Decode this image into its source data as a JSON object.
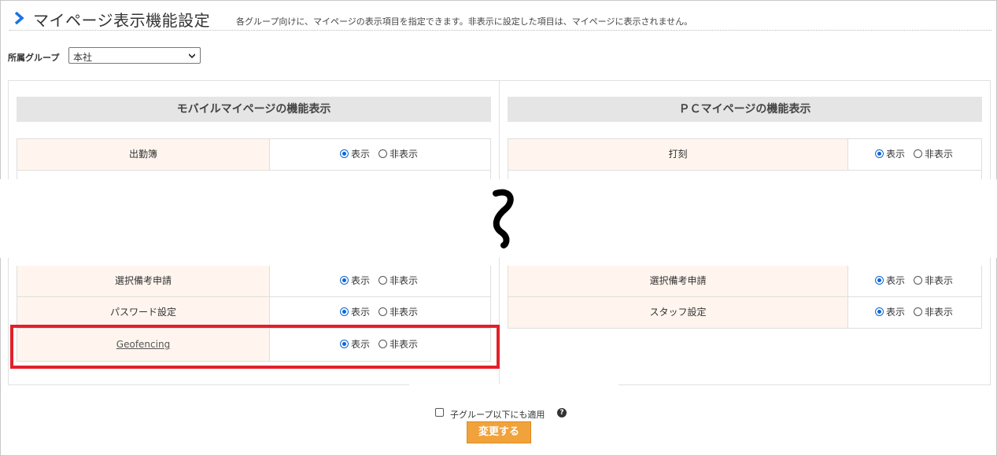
{
  "header": {
    "title": "マイページ表示機能設定",
    "description": "各グループ向けに、マイページの表示項目を指定できます。非表示に設定した項目は、マイページに表示されません。"
  },
  "group": {
    "label": "所属グループ",
    "selected": "本社"
  },
  "options": {
    "show": "表示",
    "hide": "非表示"
  },
  "mobile": {
    "title": "モバイルマイページの機能表示",
    "top_rows": [
      {
        "label": "出勤簿",
        "value": "show"
      }
    ],
    "bottom_rows": [
      {
        "label": "選択備考申請",
        "value": "show"
      },
      {
        "label": "パスワード設定",
        "value": "show"
      },
      {
        "label": "Geofencing",
        "value": "show"
      }
    ]
  },
  "pc": {
    "title": "ＰＣマイページの機能表示",
    "top_rows": [
      {
        "label": "打刻",
        "value": "show"
      }
    ],
    "bottom_rows": [
      {
        "label": "選択備考申請",
        "value": "show"
      },
      {
        "label": "スタッフ設定",
        "value": "show"
      }
    ]
  },
  "apply_children": {
    "label": "子グループ以下にも適用",
    "checked": false
  },
  "submit_label": "変更する",
  "colors": {
    "accent": "#1a73e8",
    "row_label_bg": "#fff5ee",
    "highlight": "#e2202a",
    "button": "#f2a23a"
  },
  "icons": {
    "chevron": "chevron-right-icon",
    "help": "question-circle-icon"
  }
}
